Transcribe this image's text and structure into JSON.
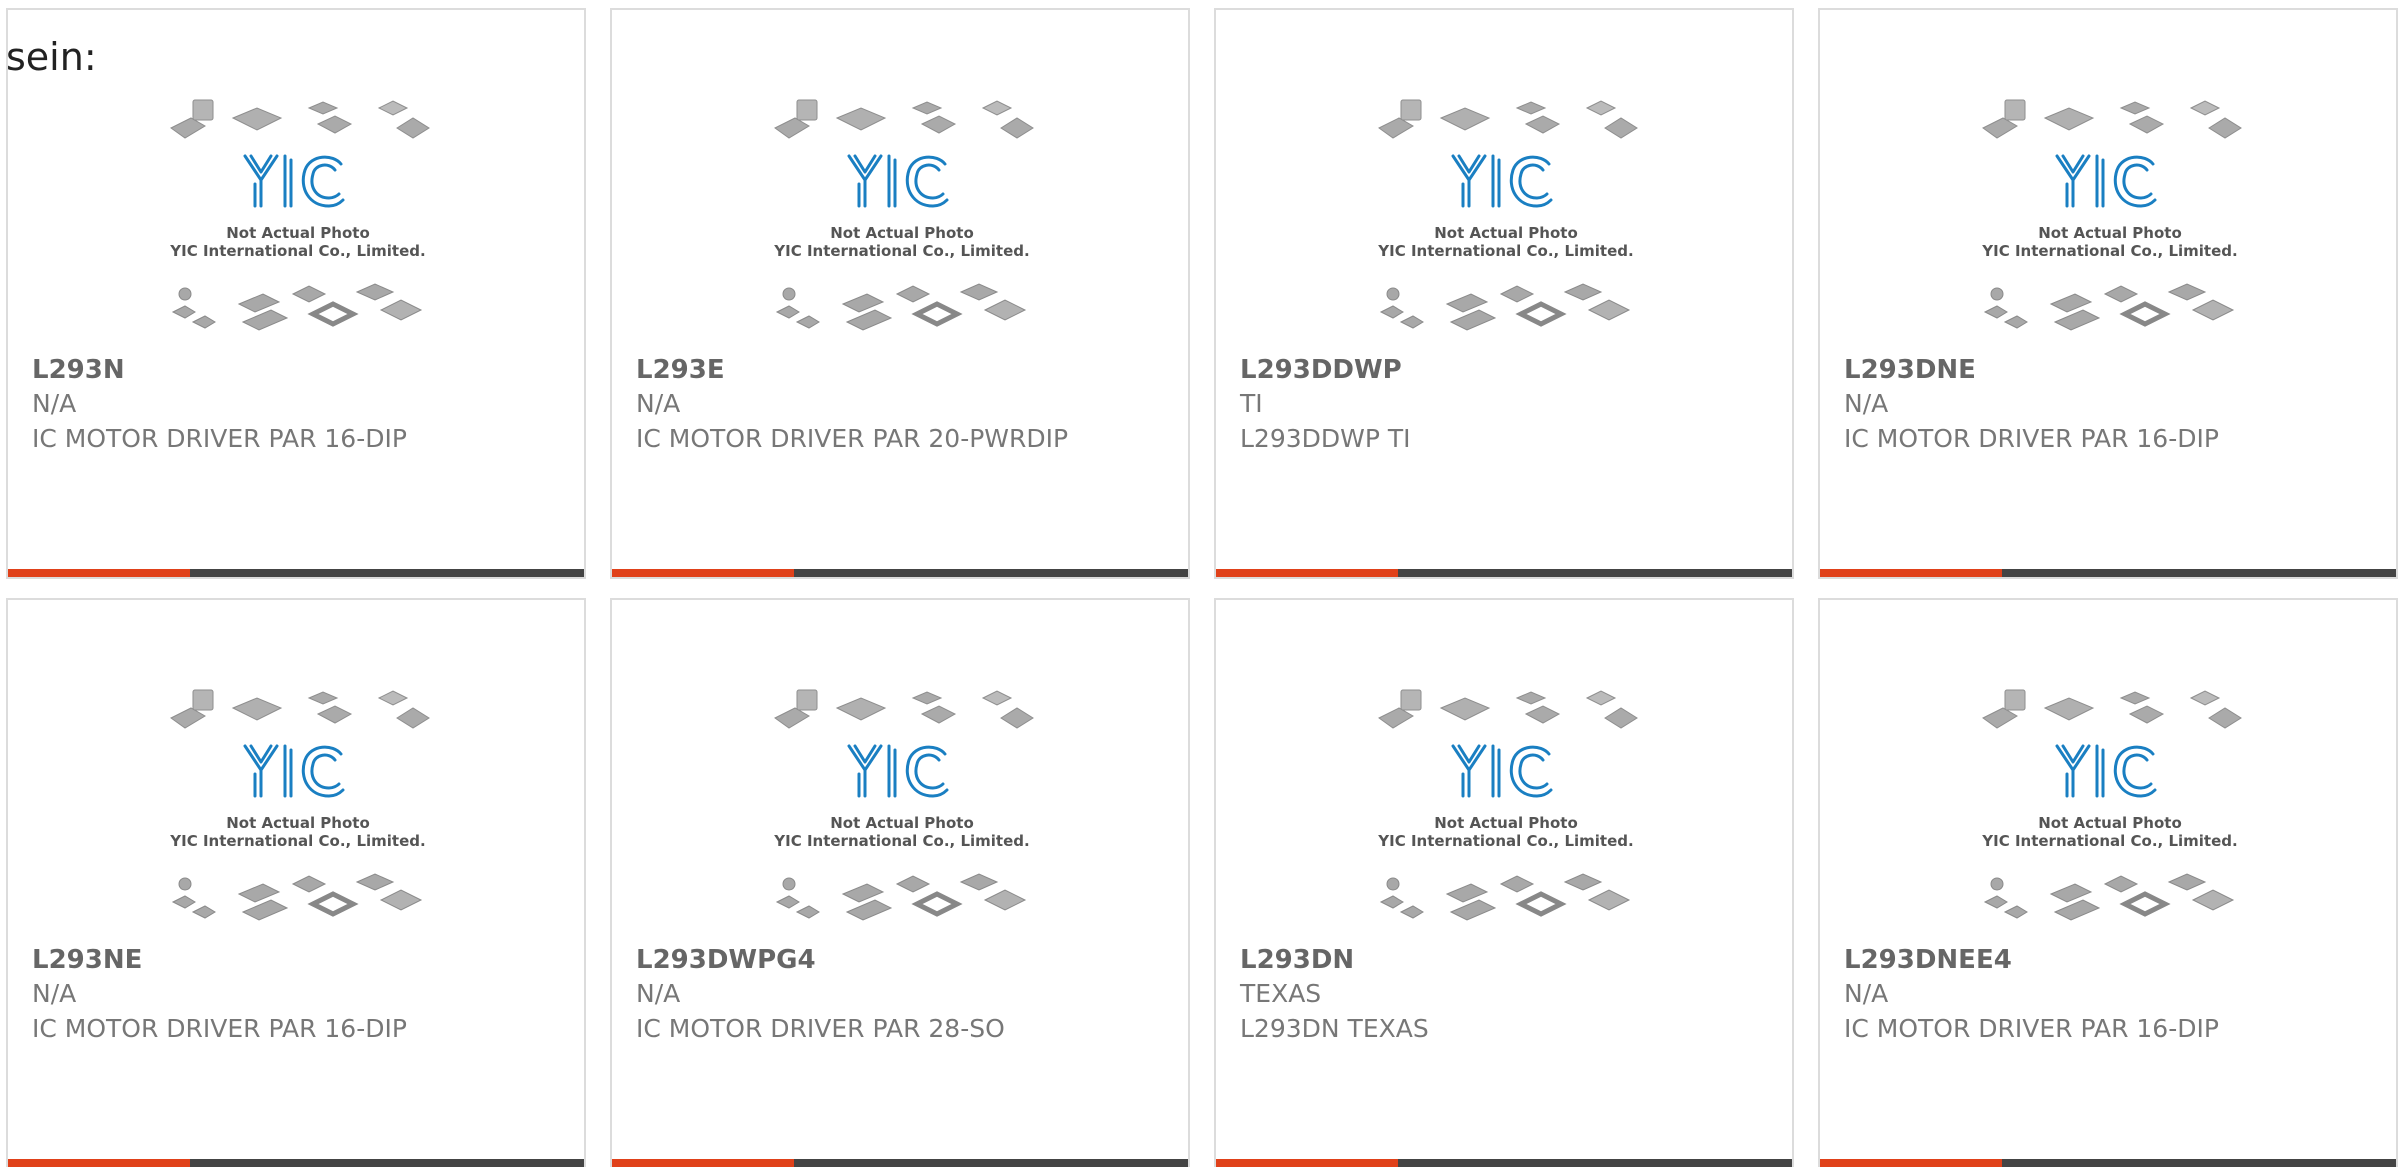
{
  "intro_text": "sein:",
  "placeholder": {
    "line1": "Not Actual Photo",
    "line2": "YIC International Co., Limited."
  },
  "colors": {
    "accent": "#e0411a",
    "bar": "#444444",
    "logo_blue": "#1a7fc2",
    "chip_gray": "#a0a0a0"
  },
  "products": [
    {
      "part": "L293N",
      "manufacturer": "N/A",
      "description": "IC MOTOR DRIVER PAR 16-DIP"
    },
    {
      "part": "L293E",
      "manufacturer": "N/A",
      "description": "IC MOTOR DRIVER PAR 20-PWRDIP"
    },
    {
      "part": "L293DDWP",
      "manufacturer": "TI",
      "description": "L293DDWP TI"
    },
    {
      "part": "L293DNE",
      "manufacturer": "N/A",
      "description": "IC MOTOR DRIVER PAR 16-DIP"
    },
    {
      "part": "L293NE",
      "manufacturer": "N/A",
      "description": "IC MOTOR DRIVER PAR 16-DIP"
    },
    {
      "part": "L293DWPG4",
      "manufacturer": "N/A",
      "description": "IC MOTOR DRIVER PAR 28-SO"
    },
    {
      "part": "L293DN",
      "manufacturer": "TEXAS",
      "description": "L293DN TEXAS"
    },
    {
      "part": "L293DNEE4",
      "manufacturer": "N/A",
      "description": "IC MOTOR DRIVER PAR 16-DIP"
    }
  ]
}
